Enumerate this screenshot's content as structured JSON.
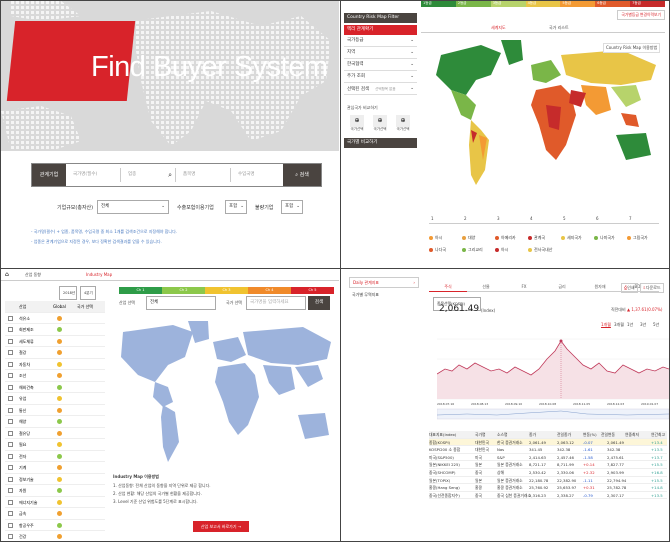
{
  "q1": {
    "title_find": "Find",
    "title_buyer": "Buyer",
    "title_system": "System",
    "search_label": "관계기업",
    "field1": "국가명(필수)",
    "field2": "업종",
    "field3": "품목명",
    "field4": "수입국명",
    "search_btn": "검색",
    "row2_label1": "기업규모(총자산)",
    "row2_sel1": "전체",
    "row2_label2": "수출포험이용기업",
    "row2_sel2": "포함",
    "row2_label3": "불량기업",
    "row2_sel3": "포함",
    "note1": "- 국가명(필수) + 업종, 품목명, 수입국명 중 최소 1개를 검색조건으로 지정해야 합니다.",
    "note2": "- 업종은 관계기업으로 지정된 경우, 보다 정확한 검색결과를 얻을 수 있습니다."
  },
  "q2": {
    "grades": [
      "1등급",
      "2등급",
      "3등급",
      "4등급",
      "5등급",
      "6등급",
      "7등급"
    ],
    "grade_colors": [
      "#2e8b3a",
      "#7ab648",
      "#b7d36b",
      "#e8c547",
      "#f39a34",
      "#e05a2a",
      "#c62b2b"
    ],
    "menu_head": "Country Risk Map Filter",
    "menu_red": "엑리 관계확기",
    "menu_items": [
      "국가등급",
      "지역",
      "한국협력",
      "주가 조회",
      "선택된 검색"
    ],
    "menu_selected_note": "선택항목 없음",
    "section2": "관심국가 비교하기",
    "compare_labels": [
      "국가선택",
      "국가선택",
      "국가선택"
    ],
    "compare_btn": "국가별 비교하기",
    "tab_map": "세계지도",
    "tab_list": "국가 리스트",
    "map_title": "Country Risk Map 이용방법",
    "top_right": "국가별등급 변경이력보기",
    "axis_labels": [
      "1",
      "2",
      "3",
      "4",
      "5",
      "6",
      "7"
    ],
    "legend": [
      "아시",
      "대양",
      "아메리카",
      "관계국",
      "세지국가",
      "나미국가",
      "그림국가",
      "나다국",
      "그리교리",
      "아시",
      "전사국내산"
    ]
  },
  "q3": {
    "nav1": "산업 동향",
    "nav2": "Industry Map",
    "year": "2018년",
    "quarter": "4분기",
    "col_industry": "산업",
    "col_global": "Global",
    "col_country": "국가 선택",
    "sel_label": "산업 선택",
    "sel_value": "전체",
    "country_label": "국가 선택",
    "country_ph": "국가명을 입력하세요",
    "search_btn": "검색",
    "stages": [
      "Ch 1",
      "Ch 2",
      "Ch 3",
      "Ch 4",
      "Ch 5"
    ],
    "stage_colors": [
      "#2e9c48",
      "#8cc84b",
      "#f0c330",
      "#f08a2a",
      "#d8232a"
    ],
    "industries": [
      "석유소",
      "회판제조",
      "세도체류",
      "철강",
      "자동차",
      "조선",
      "해외건축",
      "유업",
      "통신",
      "해양",
      "철유당",
      "필요",
      "전자",
      "기계",
      "정보기술",
      "자원",
      "에너지기술",
      "금속",
      "항공우주",
      "건강",
      "육아"
    ],
    "global_colors": [
      "#f0a030",
      "#8cc84b",
      "#f0a030",
      "#f0a030",
      "#f0c330",
      "#f0a030",
      "#8cc84b",
      "#f0c330",
      "#f0a030",
      "#8cc84b",
      "#f0a030",
      "#f0c330",
      "#8cc84b",
      "#f0a030",
      "#f0c330",
      "#8cc84b",
      "#f0c330",
      "#f0a030",
      "#8cc84b",
      "#f0a030",
      "#8cc84b"
    ],
    "info_title": "Industry Map 이용방법",
    "info1": "1. 산업동향: 전체 산업의 동향을 지역 단위로 제공 합니다.",
    "info2": "2. 산업 현황: 해당 산업의 국가별 현황을 제공합니다.",
    "info3": "3. Level 기준 산업 위험도를 5단계로 표시합니다.",
    "bottom_btn": "산업 보고서 바로가기 →"
  },
  "q4": {
    "menu1": "Daily 관계지표",
    "menu2": "국가별 무역지표",
    "tabs": [
      "주식",
      "선물",
      "FX",
      "금리",
      "원자재",
      "BDI"
    ],
    "select": "종목선택(KOSPI)",
    "value": "2,061.49",
    "value_sub": "(Index)",
    "chg_label": "직전대비",
    "chg_value": "▲ 1,37.61(0.07%)",
    "period_tabs": [
      "1개월",
      "3개월",
      "1년",
      "3년",
      "5년"
    ],
    "btn_print": "인쇄",
    "btn_save": "다운로드",
    "x_ticks": [
      "2018.07.16",
      "2018.08.13",
      "2018.09.10",
      "2018.10.08",
      "2018.11.05",
      "2018.12.03",
      "2019.01.07"
    ],
    "table_head": [
      "대표지표(Index)",
      "국가명",
      "소스명",
      "종가",
      "전일종가",
      "변동(%)",
      "전일변동",
      "연중최저",
      "연간최고"
    ],
    "rows": [
      [
        "종합(KOSPI)",
        "대한민국",
        "한국 증권거래소",
        "2,061.49",
        "2,063.12",
        "-0.07",
        "2,061.49",
        "+13.4"
      ],
      [
        "KOSPI200 소 종합",
        "대한민국",
        "Nas",
        "341.45",
        "342.38",
        "-1.61",
        "342.38",
        "+13.5"
      ],
      [
        "미국(S&P500)",
        "미국",
        "S&P",
        "2,414.63",
        "2,457.46",
        "-1.58",
        "2,475.61",
        "+13.7"
      ],
      [
        "일본(NIKKEI 225)",
        "일본",
        "일본 증권거래소",
        "8,721.17",
        "8,711.99",
        "+0.14",
        "7,827.77",
        "+15.5"
      ],
      [
        "중국(SHCOMP)",
        "중국",
        "상해",
        "2,530.42",
        "2,330.06",
        "+2.32",
        "2,903.99",
        "+16.8"
      ],
      [
        "일본(TOPIX)",
        "일본",
        "일본 증권거래소",
        "22,180.78",
        "22,382.90",
        "-1.11",
        "22,794.94",
        "+15.5"
      ],
      [
        "홍콩(Hang Seng)",
        "홍콩",
        "홍콩 증권거래소",
        "25,760.92",
        "25,653.97",
        "+0.31",
        "25,782.78",
        "+14.8"
      ],
      [
        "중국(선전종합지수)",
        "중국",
        "중국 심천 증권거래소",
        "2,316.23",
        "2,338.27",
        "-0.79",
        "2,307.17",
        "+13.5"
      ]
    ]
  }
}
